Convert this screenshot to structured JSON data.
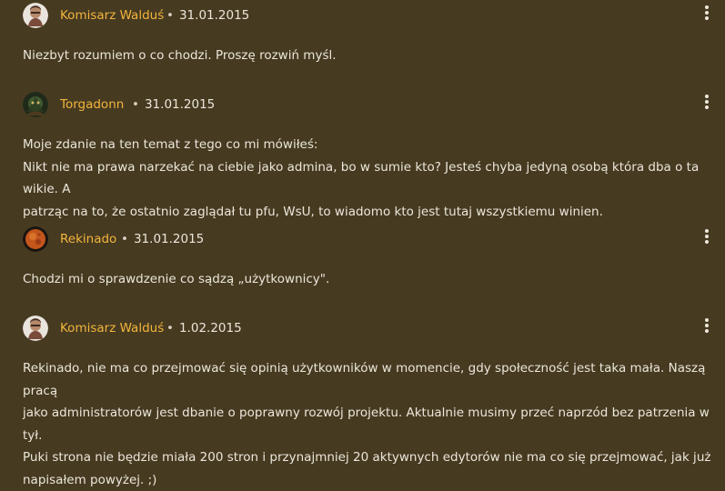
{
  "replies": [
    {
      "author": "Komisarz Walduś",
      "date": "31.01.2015",
      "separator": "•",
      "avatar_icon": "user-avatar-icon",
      "lines": [
        "Niezbyt rozumiem o co chodzi. Proszę rozwiń myśl."
      ]
    },
    {
      "author": "Torgadonn",
      "date": "31.01.2015",
      "separator": "•",
      "avatar_icon": "user-avatar-icon",
      "lines": [
        "Moje zdanie na ten temat z tego co mi mówiłeś:",
        "Nikt nie ma prawa narzekać na ciebie jako admina, bo w sumie kto? Jesteś chyba jedyną osobą która dba o ta wikie. A",
        "patrząc na to, że ostatnio zaglądał tu pfu, WsU, to wiadomo kto jest tutaj wszystkiemu winien."
      ]
    },
    {
      "author": "Rekinado",
      "date": "31.01.2015",
      "separator": "•",
      "avatar_icon": "user-avatar-icon",
      "lines": [
        "Chodzi mi o sprawdzenie co sądzą „użytkownicy\"."
      ]
    },
    {
      "author": "Komisarz Walduś",
      "date": "1.02.2015",
      "separator": "•",
      "avatar_icon": "user-avatar-icon",
      "lines": [
        "Rekinado, nie ma co przejmować się opinią użytkowników w momencie, gdy społeczność jest taka mała. Naszą pracą",
        "jako administratorów jest dbanie o poprawny rozwój projektu. Aktualnie musimy przeć naprzód bez patrzenia w tył.",
        "Puki strona nie będzie miała 200 stron i przynajmniej 20 aktywnych edytorów nie ma co się przejmować, jak już",
        "napisałem powyżej. ;)"
      ]
    }
  ],
  "menu_icon": "more-vertical-icon",
  "colors": {
    "background": "#463a21",
    "author": "#f2b53c",
    "text": "#ece6da"
  }
}
